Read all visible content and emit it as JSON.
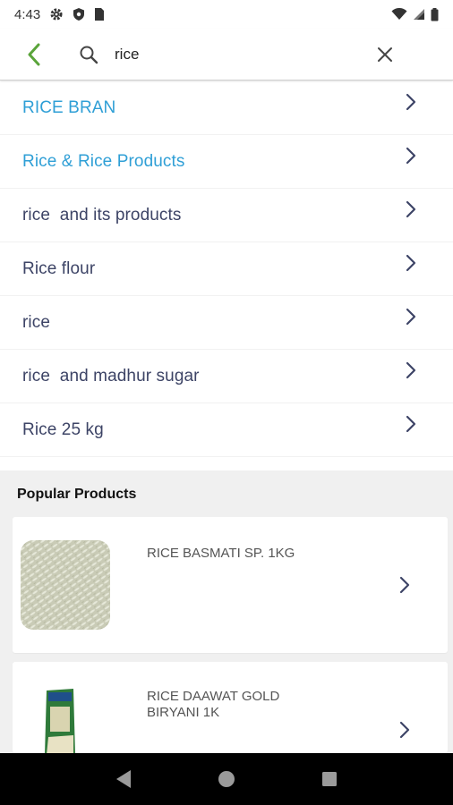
{
  "status_bar": {
    "time": "4:43",
    "icons_left": [
      "gear-icon",
      "shield-icon",
      "sim-card-icon"
    ],
    "icons_right": [
      "wifi-icon",
      "cell-signal-icon",
      "battery-icon"
    ]
  },
  "search": {
    "query": "rice",
    "back_icon": "back-arrow-icon",
    "search_icon": "search-icon",
    "clear_icon": "close-icon"
  },
  "suggestions": [
    {
      "label": "RICE BRAN",
      "highlight": true
    },
    {
      "label": "Rice & Rice Products",
      "highlight": true
    },
    {
      "label": "rice  and its products",
      "highlight": false
    },
    {
      "label": "Rice flour",
      "highlight": false
    },
    {
      "label": "rice",
      "highlight": false
    },
    {
      "label": "rice  and madhur sugar",
      "highlight": false
    },
    {
      "label": "Rice 25 kg",
      "highlight": false
    }
  ],
  "popular": {
    "title": "Popular Products",
    "products": [
      {
        "name": "RICE BASMATI SP. 1KG"
      },
      {
        "name": "RICE DAAWAT GOLD BIRYANI 1K"
      }
    ]
  },
  "colors": {
    "accent_green": "#5aa43a",
    "link_blue": "#2f9fd6",
    "text_primary": "#3d4466"
  },
  "nav_bar": {
    "icons": [
      "nav-back-icon",
      "nav-home-icon",
      "nav-recents-icon"
    ]
  }
}
